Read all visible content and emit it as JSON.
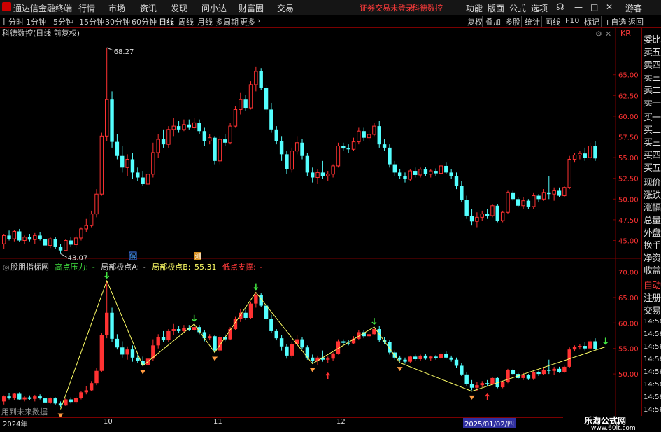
{
  "app_title": "通达信金融终端",
  "menus": [
    "行情",
    "市场",
    "资讯",
    "发现",
    "问小达",
    "财富圈",
    "交易"
  ],
  "login_notice": "证券交易未登录",
  "stock_short": "科德数控",
  "right_menus": [
    "功能",
    "版面",
    "公式",
    "选项"
  ],
  "user_label": "游客",
  "periods": [
    "分时",
    "1分钟",
    "5分钟",
    "15分钟",
    "30分钟",
    "60分钟",
    "日线",
    "周线",
    "月线",
    "多周期",
    "更多"
  ],
  "selected_period": "日线",
  "toolbar": [
    "复权",
    "叠加",
    "多股",
    "统计",
    "画线",
    "F10",
    "标记",
    "+自选",
    "返回"
  ],
  "kr_label": "KR",
  "main_title": "科德数控(日线 前复权)",
  "max_label": "68.27",
  "min_label": "43.07",
  "marker_a": "解",
  "marker_b": "测",
  "indicator": {
    "name": "股朋指标网",
    "high_label": "高点压力:",
    "high_value": "-",
    "a_label": "局部极点A:",
    "a_value": "-",
    "b_label": "局部极点B:",
    "b_value": "55.31",
    "low_label": "低点支撑:",
    "low_value": "-"
  },
  "future_note": "用到未来数据",
  "date_labels": [
    "2024年",
    "10",
    "11",
    "12",
    "2025/01/02/四"
  ],
  "side_items": [
    "委比",
    "卖五",
    "卖四",
    "卖三",
    "卖二",
    "卖一",
    "买一",
    "买二",
    "买三",
    "买四",
    "买五",
    "现价",
    "涨跌",
    "涨幅",
    "总量",
    "外盘",
    "换手",
    "净资",
    "收益",
    "自动",
    "注册",
    "交易"
  ],
  "side_times": [
    "14:56",
    "14:56",
    "14:56",
    "14:56",
    "14:56",
    "14:56",
    "14:56",
    "14:56"
  ],
  "watermark": "乐淘公式网",
  "watermark_url": "www.60lt.com",
  "colors": {
    "up": "#ff3232",
    "down": "#54ffff",
    "grid": "#7a0000",
    "axis_text": "#ff3232",
    "zigzag": "#ffff66"
  },
  "chart_data": {
    "type": "candlestick",
    "main_axis": {
      "ticks": [
        65.0,
        62.5,
        60.0,
        57.5,
        55.0,
        52.5,
        50.0,
        47.5,
        45.0
      ]
    },
    "indicator_axis": {
      "ticks": [
        70.0,
        65.0,
        60.0,
        55.0,
        50.0
      ]
    },
    "candles": [
      [
        44.6,
        45.8,
        44.0,
        45.6
      ],
      [
        45.6,
        46.2,
        45.0,
        45.2
      ],
      [
        45.2,
        46.3,
        44.9,
        46.1
      ],
      [
        46.1,
        46.4,
        44.8,
        45.0
      ],
      [
        45.0,
        45.6,
        44.6,
        45.4
      ],
      [
        45.4,
        45.8,
        44.9,
        45.1
      ],
      [
        45.1,
        45.9,
        44.6,
        45.6
      ],
      [
        45.6,
        46.0,
        45.0,
        45.2
      ],
      [
        45.2,
        45.6,
        44.2,
        44.4
      ],
      [
        44.4,
        45.4,
        44.1,
        45.2
      ],
      [
        45.2,
        45.4,
        44.0,
        44.2
      ],
      [
        44.2,
        44.6,
        43.4,
        43.8
      ],
      [
        43.8,
        45.2,
        43.7,
        45.0
      ],
      [
        45.0,
        45.4,
        44.2,
        44.5
      ],
      [
        44.5,
        45.6,
        44.1,
        45.3
      ],
      [
        45.3,
        46.6,
        45.0,
        46.4
      ],
      [
        46.4,
        47.6,
        46.0,
        46.8
      ],
      [
        46.8,
        48.6,
        46.6,
        48.2
      ],
      [
        48.2,
        51.2,
        47.8,
        50.6
      ],
      [
        50.6,
        58.0,
        50.4,
        57.6
      ],
      [
        57.6,
        68.27,
        57.0,
        62.0
      ],
      [
        62.0,
        63.0,
        56.2,
        56.9
      ],
      [
        56.9,
        57.8,
        54.8,
        55.2
      ],
      [
        55.2,
        56.4,
        53.2,
        53.8
      ],
      [
        53.8,
        55.4,
        52.8,
        54.8
      ],
      [
        54.8,
        55.6,
        52.4,
        53.2
      ],
      [
        53.2,
        53.8,
        52.2,
        52.6
      ],
      [
        52.6,
        53.4,
        51.6,
        51.8
      ],
      [
        51.8,
        53.6,
        51.4,
        53.0
      ],
      [
        53.0,
        56.8,
        52.6,
        55.6
      ],
      [
        55.6,
        57.8,
        55.0,
        57.2
      ],
      [
        57.2,
        58.4,
        56.2,
        56.6
      ],
      [
        56.6,
        58.8,
        56.2,
        58.4
      ],
      [
        58.4,
        59.8,
        57.6,
        58.8
      ],
      [
        58.8,
        59.4,
        58.0,
        58.4
      ],
      [
        58.4,
        59.6,
        58.2,
        59.0
      ],
      [
        59.0,
        59.6,
        58.4,
        58.6
      ],
      [
        58.6,
        59.8,
        58.4,
        59.2
      ],
      [
        59.2,
        59.6,
        57.8,
        58.2
      ],
      [
        58.2,
        58.6,
        56.4,
        57.0
      ],
      [
        57.0,
        57.8,
        56.6,
        57.4
      ],
      [
        57.4,
        57.6,
        54.2,
        54.6
      ],
      [
        54.6,
        57.6,
        54.2,
        57.2
      ],
      [
        57.2,
        57.8,
        56.4,
        56.8
      ],
      [
        56.8,
        59.2,
        56.6,
        58.8
      ],
      [
        58.8,
        61.2,
        58.6,
        60.8
      ],
      [
        60.8,
        62.8,
        60.2,
        62.0
      ],
      [
        62.0,
        62.6,
        60.6,
        61.0
      ],
      [
        61.0,
        64.2,
        60.8,
        63.8
      ],
      [
        63.8,
        66.0,
        63.0,
        65.4
      ],
      [
        65.4,
        65.8,
        63.2,
        63.4
      ],
      [
        63.4,
        63.8,
        60.4,
        60.8
      ],
      [
        60.8,
        61.6,
        58.0,
        58.4
      ],
      [
        58.4,
        58.8,
        56.6,
        57.0
      ],
      [
        57.0,
        57.6,
        54.6,
        55.4
      ],
      [
        55.4,
        55.8,
        53.0,
        53.6
      ],
      [
        53.6,
        56.2,
        53.2,
        55.8
      ],
      [
        55.8,
        57.6,
        55.4,
        56.8
      ],
      [
        56.8,
        57.2,
        54.8,
        55.2
      ],
      [
        55.2,
        55.6,
        52.8,
        53.2
      ],
      [
        53.2,
        53.8,
        52.0,
        52.6
      ],
      [
        52.6,
        53.6,
        51.8,
        53.2
      ],
      [
        53.2,
        54.6,
        52.4,
        52.8
      ],
      [
        52.8,
        53.4,
        52.2,
        53.0
      ],
      [
        53.0,
        54.2,
        52.6,
        54.0
      ],
      [
        54.0,
        56.8,
        53.8,
        56.4
      ],
      [
        56.4,
        56.8,
        55.8,
        56.1
      ],
      [
        56.1,
        56.6,
        55.6,
        56.0
      ],
      [
        56.0,
        57.4,
        55.8,
        56.9
      ],
      [
        56.9,
        58.6,
        56.6,
        58.2
      ],
      [
        58.2,
        58.6,
        57.0,
        57.4
      ],
      [
        57.4,
        58.4,
        57.0,
        57.8
      ],
      [
        57.8,
        59.2,
        57.6,
        58.8
      ],
      [
        58.8,
        59.4,
        56.2,
        56.6
      ],
      [
        56.6,
        57.2,
        55.8,
        56.2
      ],
      [
        56.2,
        56.6,
        53.8,
        54.2
      ],
      [
        54.2,
        54.6,
        52.8,
        53.2
      ],
      [
        53.2,
        53.6,
        52.4,
        52.8
      ],
      [
        52.8,
        53.2,
        52.0,
        52.4
      ],
      [
        52.4,
        53.6,
        52.2,
        53.4
      ],
      [
        53.4,
        53.8,
        52.6,
        52.9
      ],
      [
        52.9,
        53.8,
        52.6,
        53.6
      ],
      [
        53.6,
        53.9,
        52.8,
        53.0
      ],
      [
        53.0,
        53.6,
        52.6,
        53.4
      ],
      [
        53.4,
        53.7,
        52.8,
        53.1
      ],
      [
        53.1,
        54.2,
        52.9,
        54.0
      ],
      [
        54.0,
        54.4,
        53.0,
        53.2
      ],
      [
        53.2,
        53.6,
        52.4,
        52.8
      ],
      [
        52.8,
        53.2,
        51.2,
        51.6
      ],
      [
        51.6,
        52.2,
        49.6,
        49.9
      ],
      [
        49.9,
        50.4,
        47.6,
        48.0
      ],
      [
        48.0,
        48.8,
        46.8,
        47.3
      ],
      [
        47.3,
        48.4,
        46.6,
        47.8
      ],
      [
        47.8,
        48.6,
        47.4,
        48.2
      ],
      [
        48.2,
        48.8,
        47.6,
        48.0
      ],
      [
        48.0,
        49.4,
        47.8,
        49.2
      ],
      [
        49.2,
        49.4,
        47.2,
        47.4
      ],
      [
        47.4,
        48.6,
        47.2,
        48.4
      ],
      [
        48.4,
        51.0,
        48.2,
        50.8
      ],
      [
        50.8,
        51.0,
        49.8,
        50.0
      ],
      [
        50.0,
        50.2,
        49.0,
        49.2
      ],
      [
        49.2,
        50.2,
        48.8,
        49.8
      ],
      [
        49.8,
        50.0,
        48.8,
        49.1
      ],
      [
        49.1,
        50.8,
        48.8,
        50.4
      ],
      [
        50.4,
        50.6,
        49.6,
        50.0
      ],
      [
        50.0,
        51.2,
        49.8,
        50.8
      ],
      [
        50.8,
        52.8,
        50.0,
        50.6
      ],
      [
        50.6,
        51.4,
        49.8,
        51.0
      ],
      [
        51.0,
        51.4,
        50.2,
        50.4
      ],
      [
        50.4,
        51.6,
        50.2,
        51.4
      ],
      [
        51.4,
        55.2,
        51.2,
        54.8
      ],
      [
        54.8,
        55.6,
        54.4,
        55.3
      ],
      [
        55.3,
        55.8,
        54.8,
        55.5
      ],
      [
        55.5,
        56.2,
        54.6,
        55.0
      ],
      [
        55.0,
        56.8,
        54.8,
        56.4
      ],
      [
        56.4,
        57.0,
        54.6,
        54.9
      ]
    ],
    "pivots": [
      {
        "i": 11,
        "type": "low",
        "value": 43.07
      },
      {
        "i": 20,
        "type": "high",
        "value": 68.27
      },
      {
        "i": 27,
        "type": "low",
        "value": 51.6
      },
      {
        "i": 37,
        "type": "high",
        "value": 59.8
      },
      {
        "i": 41,
        "type": "low",
        "value": 54.2
      },
      {
        "i": 49,
        "type": "high",
        "value": 66.0
      },
      {
        "i": 60,
        "type": "low",
        "value": 52.0
      },
      {
        "i": 72,
        "type": "high",
        "value": 59.2
      },
      {
        "i": 77,
        "type": "low",
        "value": 52.2
      },
      {
        "i": 91,
        "type": "low",
        "value": 46.6
      },
      {
        "i": 117,
        "type": "high",
        "value": 55.31
      }
    ]
  }
}
